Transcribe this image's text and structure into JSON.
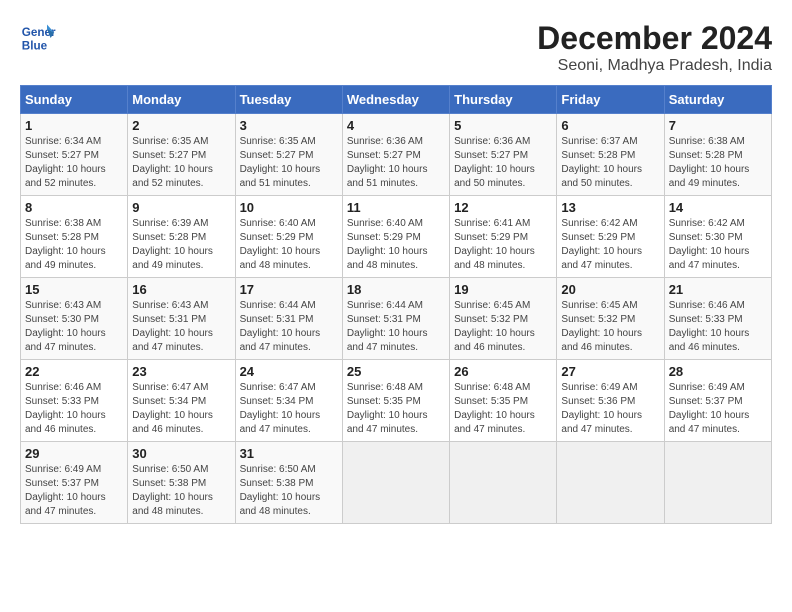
{
  "header": {
    "logo_line1": "General",
    "logo_line2": "Blue",
    "month": "December 2024",
    "location": "Seoni, Madhya Pradesh, India"
  },
  "calendar": {
    "weekdays": [
      "Sunday",
      "Monday",
      "Tuesday",
      "Wednesday",
      "Thursday",
      "Friday",
      "Saturday"
    ],
    "weeks": [
      [
        {
          "day": "1",
          "info": "Sunrise: 6:34 AM\nSunset: 5:27 PM\nDaylight: 10 hours\nand 52 minutes."
        },
        {
          "day": "2",
          "info": "Sunrise: 6:35 AM\nSunset: 5:27 PM\nDaylight: 10 hours\nand 52 minutes."
        },
        {
          "day": "3",
          "info": "Sunrise: 6:35 AM\nSunset: 5:27 PM\nDaylight: 10 hours\nand 51 minutes."
        },
        {
          "day": "4",
          "info": "Sunrise: 6:36 AM\nSunset: 5:27 PM\nDaylight: 10 hours\nand 51 minutes."
        },
        {
          "day": "5",
          "info": "Sunrise: 6:36 AM\nSunset: 5:27 PM\nDaylight: 10 hours\nand 50 minutes."
        },
        {
          "day": "6",
          "info": "Sunrise: 6:37 AM\nSunset: 5:28 PM\nDaylight: 10 hours\nand 50 minutes."
        },
        {
          "day": "7",
          "info": "Sunrise: 6:38 AM\nSunset: 5:28 PM\nDaylight: 10 hours\nand 49 minutes."
        }
      ],
      [
        {
          "day": "8",
          "info": "Sunrise: 6:38 AM\nSunset: 5:28 PM\nDaylight: 10 hours\nand 49 minutes."
        },
        {
          "day": "9",
          "info": "Sunrise: 6:39 AM\nSunset: 5:28 PM\nDaylight: 10 hours\nand 49 minutes."
        },
        {
          "day": "10",
          "info": "Sunrise: 6:40 AM\nSunset: 5:29 PM\nDaylight: 10 hours\nand 48 minutes."
        },
        {
          "day": "11",
          "info": "Sunrise: 6:40 AM\nSunset: 5:29 PM\nDaylight: 10 hours\nand 48 minutes."
        },
        {
          "day": "12",
          "info": "Sunrise: 6:41 AM\nSunset: 5:29 PM\nDaylight: 10 hours\nand 48 minutes."
        },
        {
          "day": "13",
          "info": "Sunrise: 6:42 AM\nSunset: 5:29 PM\nDaylight: 10 hours\nand 47 minutes."
        },
        {
          "day": "14",
          "info": "Sunrise: 6:42 AM\nSunset: 5:30 PM\nDaylight: 10 hours\nand 47 minutes."
        }
      ],
      [
        {
          "day": "15",
          "info": "Sunrise: 6:43 AM\nSunset: 5:30 PM\nDaylight: 10 hours\nand 47 minutes."
        },
        {
          "day": "16",
          "info": "Sunrise: 6:43 AM\nSunset: 5:31 PM\nDaylight: 10 hours\nand 47 minutes."
        },
        {
          "day": "17",
          "info": "Sunrise: 6:44 AM\nSunset: 5:31 PM\nDaylight: 10 hours\nand 47 minutes."
        },
        {
          "day": "18",
          "info": "Sunrise: 6:44 AM\nSunset: 5:31 PM\nDaylight: 10 hours\nand 47 minutes."
        },
        {
          "day": "19",
          "info": "Sunrise: 6:45 AM\nSunset: 5:32 PM\nDaylight: 10 hours\nand 46 minutes."
        },
        {
          "day": "20",
          "info": "Sunrise: 6:45 AM\nSunset: 5:32 PM\nDaylight: 10 hours\nand 46 minutes."
        },
        {
          "day": "21",
          "info": "Sunrise: 6:46 AM\nSunset: 5:33 PM\nDaylight: 10 hours\nand 46 minutes."
        }
      ],
      [
        {
          "day": "22",
          "info": "Sunrise: 6:46 AM\nSunset: 5:33 PM\nDaylight: 10 hours\nand 46 minutes."
        },
        {
          "day": "23",
          "info": "Sunrise: 6:47 AM\nSunset: 5:34 PM\nDaylight: 10 hours\nand 46 minutes."
        },
        {
          "day": "24",
          "info": "Sunrise: 6:47 AM\nSunset: 5:34 PM\nDaylight: 10 hours\nand 47 minutes."
        },
        {
          "day": "25",
          "info": "Sunrise: 6:48 AM\nSunset: 5:35 PM\nDaylight: 10 hours\nand 47 minutes."
        },
        {
          "day": "26",
          "info": "Sunrise: 6:48 AM\nSunset: 5:35 PM\nDaylight: 10 hours\nand 47 minutes."
        },
        {
          "day": "27",
          "info": "Sunrise: 6:49 AM\nSunset: 5:36 PM\nDaylight: 10 hours\nand 47 minutes."
        },
        {
          "day": "28",
          "info": "Sunrise: 6:49 AM\nSunset: 5:37 PM\nDaylight: 10 hours\nand 47 minutes."
        }
      ],
      [
        {
          "day": "29",
          "info": "Sunrise: 6:49 AM\nSunset: 5:37 PM\nDaylight: 10 hours\nand 47 minutes."
        },
        {
          "day": "30",
          "info": "Sunrise: 6:50 AM\nSunset: 5:38 PM\nDaylight: 10 hours\nand 48 minutes."
        },
        {
          "day": "31",
          "info": "Sunrise: 6:50 AM\nSunset: 5:38 PM\nDaylight: 10 hours\nand 48 minutes."
        },
        null,
        null,
        null,
        null
      ]
    ]
  }
}
